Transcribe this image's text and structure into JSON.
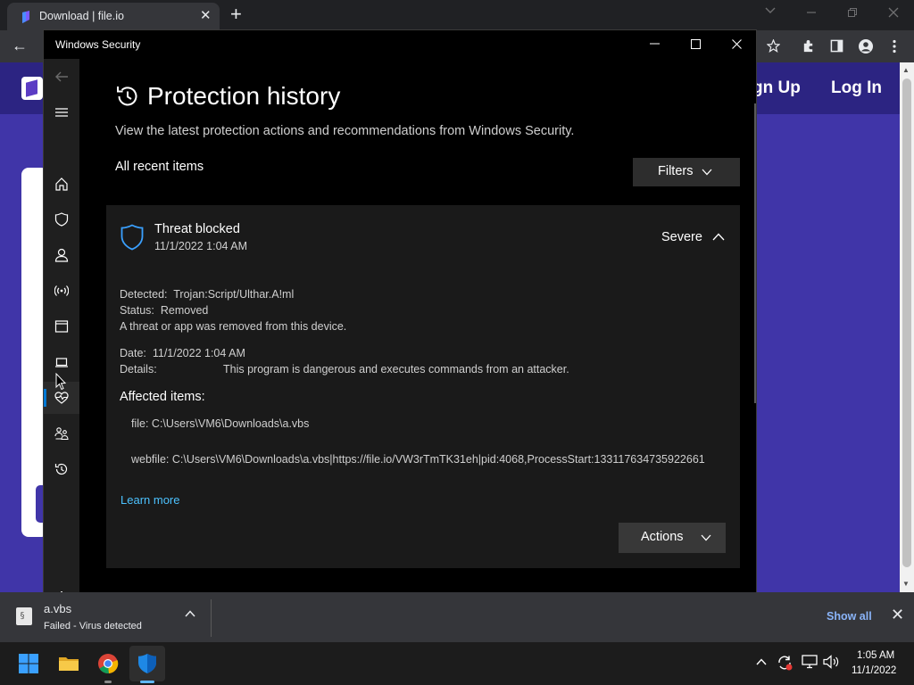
{
  "browser": {
    "tab_title": "Download | file.io",
    "tab_close": "✕",
    "new_tab": "+",
    "back": "←",
    "toolbar_icons": [
      "star-icon",
      "extensions-icon",
      "side-panel-icon",
      "profile-icon",
      "menu-icon"
    ]
  },
  "site": {
    "sign_up": "gn Up",
    "log_in": "Log In"
  },
  "window": {
    "title": "Windows Security",
    "min": "—",
    "max": "☐",
    "close": "✕"
  },
  "nav": {
    "items": [
      {
        "name": "nav-back",
        "icon": "back-arrow-icon"
      },
      {
        "name": "nav-menu",
        "icon": "hamburger-icon"
      },
      {
        "name": "nav-home",
        "icon": "home-icon"
      },
      {
        "name": "nav-virus-protection",
        "icon": "shield-icon"
      },
      {
        "name": "nav-account-protection",
        "icon": "person-icon"
      },
      {
        "name": "nav-firewall",
        "icon": "wifi-antenna-icon"
      },
      {
        "name": "nav-app-browser",
        "icon": "browser-window-icon"
      },
      {
        "name": "nav-device-security",
        "icon": "laptop-icon"
      },
      {
        "name": "nav-device-health",
        "icon": "heart-pulse-icon"
      },
      {
        "name": "nav-family",
        "icon": "family-icon"
      },
      {
        "name": "nav-history",
        "icon": "history-icon"
      },
      {
        "name": "nav-settings",
        "icon": "gear-icon"
      }
    ]
  },
  "page": {
    "title": "Protection history",
    "description": "View the latest protection actions and recommendations from Windows Security.",
    "section_label": "All recent items",
    "filters_label": "Filters"
  },
  "threat": {
    "title": "Threat blocked",
    "date": "11/1/2022 1:04 AM",
    "severity": "Severe",
    "detected_label": "Detected:",
    "detected_value": "Trojan:Script/Ulthar.A!ml",
    "status_label": "Status:",
    "status_value": "Removed",
    "message": "A threat or app was removed from this device.",
    "date_label": "Date:",
    "date_value": "11/1/2022 1:04 AM",
    "details_label": "Details:",
    "details_value": "This program is dangerous and executes commands from an attacker.",
    "affected_header": "Affected items:",
    "affected_items": [
      "file: C:\\Users\\VM6\\Downloads\\a.vbs",
      "webfile: C:\\Users\\VM6\\Downloads\\a.vbs|https://file.io/VW3rTmTK31eh|pid:4068,ProcessStart:133117634735922661"
    ],
    "learn_more": "Learn more",
    "actions_label": "Actions"
  },
  "download": {
    "file_name": "a.vbs",
    "status": "Failed - Virus detected",
    "show_all": "Show all",
    "close": "✕"
  },
  "taskbar": {
    "apps": [
      "start-icon",
      "file-explorer-icon",
      "chrome-icon",
      "windows-security-icon"
    ],
    "time": "1:05 AM",
    "date": "11/1/2022"
  },
  "colors": {
    "accent": "#0078d4",
    "link": "#4cc2ff",
    "site_brand": "#4035a8"
  }
}
